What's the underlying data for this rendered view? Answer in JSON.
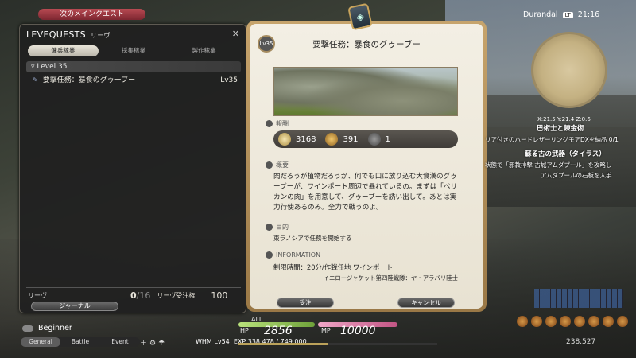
{
  "top_tab": {
    "label": "次のメインクエスト"
  },
  "levequest_window": {
    "title": "LEVEQUESTS",
    "subtitle": "リーヴ",
    "tabs": [
      "傭兵稼業",
      "採集稼業",
      "製作稼業"
    ],
    "level_group": "Level 35",
    "quests": [
      {
        "name": "要撃任務：暴食のグゥーブー",
        "level": "Lv35"
      }
    ],
    "footer": {
      "leve_label": "リーヴ",
      "leves_available": "0",
      "leves_max": "/16",
      "accepted_label": "リーヴ受注権",
      "accepted_value": "100"
    },
    "journal_button": "ジャーナル"
  },
  "card": {
    "level_badge": "Lv35",
    "title": "要撃任務：暴食のグゥーブー",
    "reward_label": "報酬",
    "rewards": {
      "exp": "3168",
      "gil": "391",
      "seals": "1"
    },
    "overview_label": "概要",
    "description": "肉だろうが植物だろうが、何でも口に放り込む大食漢のグゥーブーが、ワインポート周辺で暴れているの。まずは「ペリカンの肉」を用意して、グゥーブーを誘い出して。あとは実力行使あるのみ。全力で戦うのよ。",
    "objective_label": "目的",
    "objective": "東ラノシアで任務を開始する",
    "info_label": "INFORMATION",
    "info_time": "制限時間：20分/作戦任地 ワインポート",
    "info_client": "イエロージャケット第四陸戦隊：ヤ・アラバリ陸士",
    "accept_button": "受注",
    "cancel_button": "キャンセル"
  },
  "chat": {
    "line": "Beginner",
    "tabs": [
      "General",
      "Battle",
      "Event"
    ]
  },
  "status": {
    "all_label": "ALL",
    "hp_label": "HP",
    "hp_value": "2856",
    "hp_fraction": 1.0,
    "mp_label": "MP",
    "mp_value": "10000",
    "mp_fraction": 1.0,
    "job": "WHM",
    "level": "Lv54",
    "exp": "EXP 338,478 / 749,000",
    "exp_fraction": 0.45
  },
  "hud": {
    "server": "Durandal",
    "lt_badge": "LT",
    "time": "21:16",
    "coords": "X:21.5 Y:21.4 Z:0.6",
    "quests": [
      {
        "title": "巴術士と錬金術",
        "step": "リア付きのハードレザーリングモアDXを納品 0/1"
      },
      {
        "title": "蘇る古の武器（タイラス）",
        "step": "状態で「邪教排撃 古城アムダプール」を攻略し",
        "step2": "アムダプールの石板を入手"
      }
    ],
    "gil": "238,527"
  }
}
